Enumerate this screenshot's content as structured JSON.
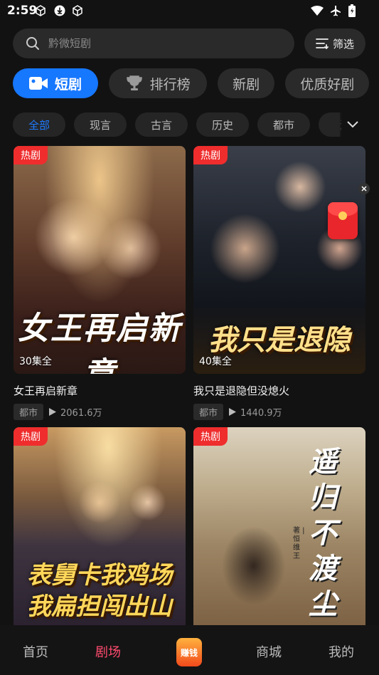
{
  "status_bar": {
    "time": "2:59"
  },
  "search": {
    "placeholder": "黔微短剧",
    "filter_label": "筛选"
  },
  "category_tabs": [
    {
      "label": "短剧",
      "icon": "video-camera-icon"
    },
    {
      "label": "排行榜",
      "icon": "trophy-icon"
    },
    {
      "label": "新剧"
    },
    {
      "label": "优质好剧"
    }
  ],
  "genres": [
    "全部",
    "现言",
    "古言",
    "历史",
    "都市",
    "活"
  ],
  "cards": [
    {
      "badge": "热剧",
      "episodes": "30集全",
      "poster_text": "女王再启新章",
      "title": "女王再启新章",
      "tag": "都市",
      "plays": "2061.6万"
    },
    {
      "badge": "热剧",
      "episodes": "40集全",
      "poster_text": "我只是退隐",
      "title": "我只是退隐但没熄火",
      "tag": "都市",
      "plays": "1440.9万"
    },
    {
      "badge": "热剧",
      "poster_text_1": "表舅卡我鸡场",
      "poster_text_2": "我扁担闯出山"
    },
    {
      "badge": "热剧",
      "poster_text": "遥归不渡尘",
      "side_text": "著 | 恒维王"
    }
  ],
  "bottom_nav": {
    "home": "首页",
    "theater": "剧场",
    "earn": "赚钱",
    "mall": "商城",
    "mine": "我的"
  },
  "colors": {
    "accent": "#1677ff",
    "badge": "#ef2d2d",
    "nav_active": "#ff4b6e"
  }
}
